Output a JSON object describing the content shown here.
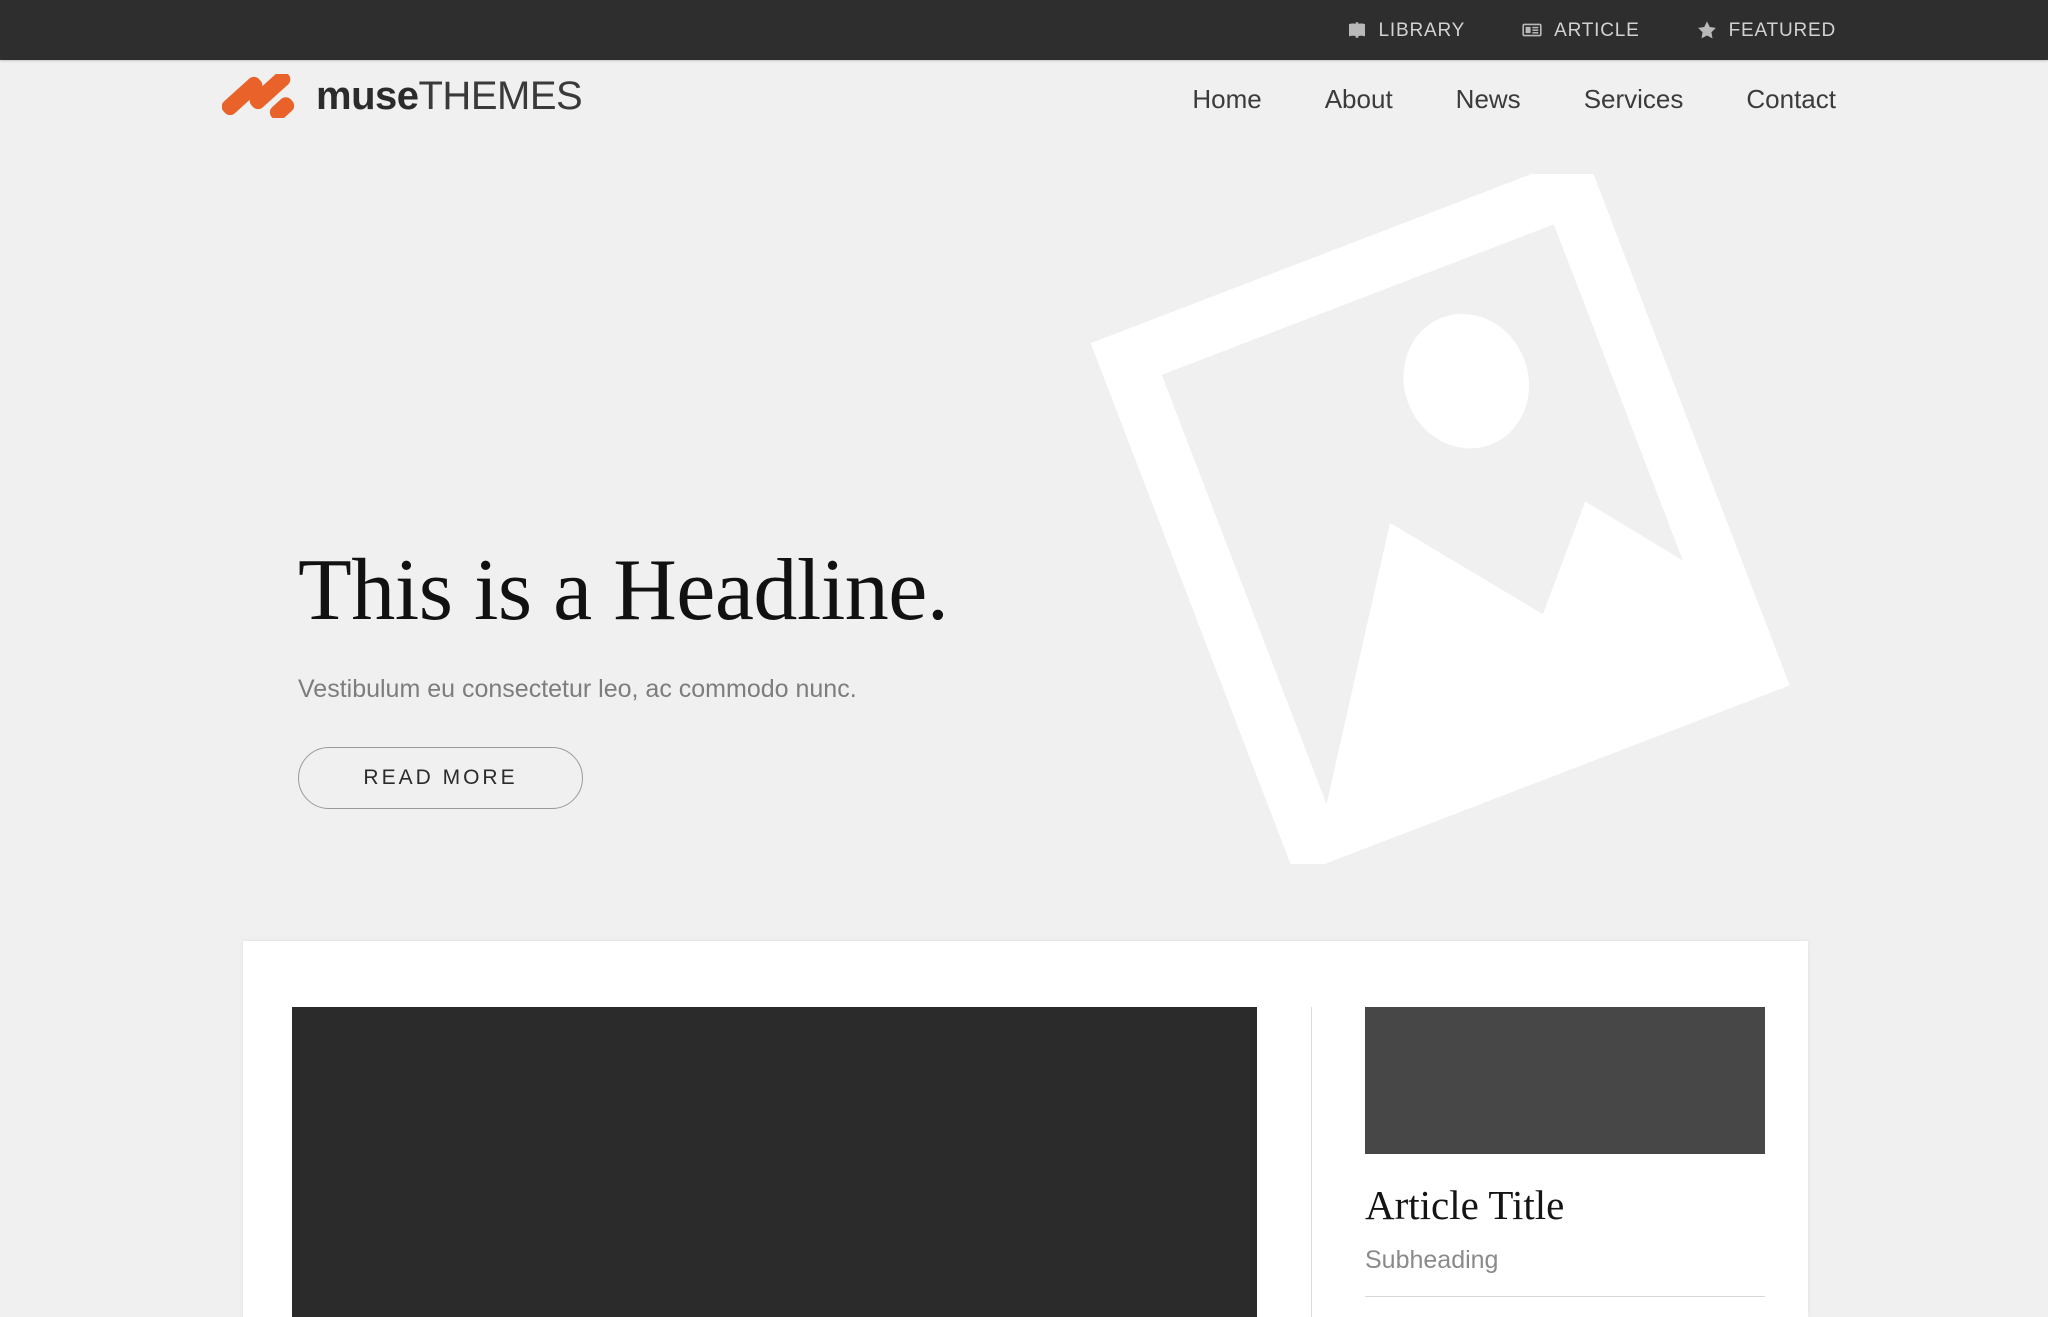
{
  "topbar": {
    "links": [
      {
        "label": "LIBRARY",
        "icon": "book-icon"
      },
      {
        "label": "ARTICLE",
        "icon": "newspaper-icon"
      },
      {
        "label": "FEATURED",
        "icon": "star-icon"
      }
    ]
  },
  "header": {
    "logo": {
      "mark_icon": "muse-chevron-logo-icon",
      "name_bold": "muse",
      "name_light": "THEMES",
      "mark_color": "#e8622a"
    },
    "nav": [
      {
        "label": "Home"
      },
      {
        "label": "About"
      },
      {
        "label": "News"
      },
      {
        "label": "Services"
      },
      {
        "label": "Contact"
      }
    ]
  },
  "hero": {
    "watermark_icon": "image-placeholder-icon",
    "headline": "This is a Headline.",
    "subtext": "Vestibulum eu consectetur leo, ac commodo nunc.",
    "button_label": "READ MORE",
    "background_color": "#f0f0f0"
  },
  "card": {
    "feature": {
      "media_placeholder_color": "#2b2b2b"
    },
    "article": {
      "thumb_placeholder_color": "#474747",
      "title": "Article Title",
      "subheading": "Subheading"
    }
  }
}
